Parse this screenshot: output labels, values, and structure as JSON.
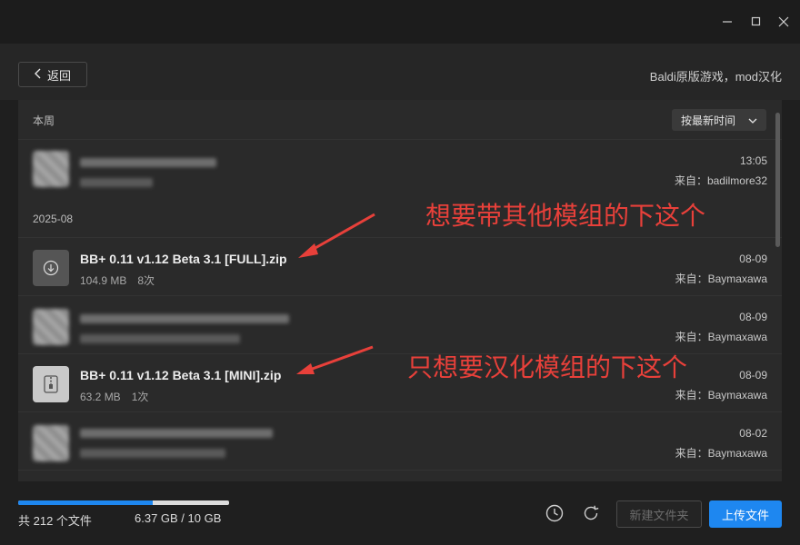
{
  "window": {
    "controls": [
      "minimize-icon",
      "maximize-icon",
      "close-icon"
    ]
  },
  "header": {
    "back_label": "返回",
    "breadcrumb": "Baldi原版游戏，mod汉化"
  },
  "list": {
    "section_week": "本周",
    "section_month": "2025-08",
    "sort_label": "按最新时间",
    "rows": [
      {
        "name": "",
        "size": "",
        "count": "",
        "date": "13:05",
        "source": "来自：badilmore32",
        "icon": "blurred-thumbnail"
      },
      {
        "name": "BB+ 0.11 v1.12 Beta 3.1 [FULL].zip",
        "size": "104.9 MB",
        "count": "8次",
        "date": "08-09",
        "source": "来自：Baymaxawa",
        "icon": "download-icon"
      },
      {
        "name": "",
        "size": "",
        "count": "",
        "date": "08-09",
        "source": "来自：Baymaxawa",
        "icon": "blurred-thumbnail"
      },
      {
        "name": "BB+ 0.11 v1.12 Beta 3.1 [MINI].zip",
        "size": "63.2 MB",
        "count": "1次",
        "date": "08-09",
        "source": "来自：Baymaxawa",
        "icon": "zip-icon"
      },
      {
        "name": "",
        "size": "",
        "count": "",
        "date": "08-02",
        "source": "来自：Baymaxawa",
        "icon": "blurred-thumbnail"
      }
    ]
  },
  "annotations": {
    "full": "想要带其他模组的下这个",
    "mini": "只想要汉化模组的下这个",
    "color": "#e8403a"
  },
  "footer": {
    "file_count": "共 212 个文件",
    "storage": "6.37 GB / 10 GB",
    "storage_used_fraction": 0.637,
    "new_folder_label": "新建文件夹",
    "upload_label": "上传文件",
    "accent": "#1e87f0"
  }
}
